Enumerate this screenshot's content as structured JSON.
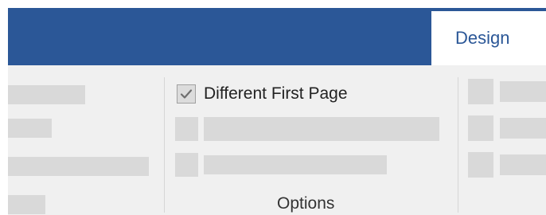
{
  "ribbon_tab": {
    "label": "Design"
  },
  "options_group": {
    "checkbox": {
      "label": "Different First Page",
      "checked": true
    },
    "group_label": "Options"
  },
  "colors": {
    "title_bar": "#2b5797",
    "tab_text": "#2b5797",
    "ribbon_background": "#f0f0f0",
    "placeholder": "#d9d9d9"
  }
}
